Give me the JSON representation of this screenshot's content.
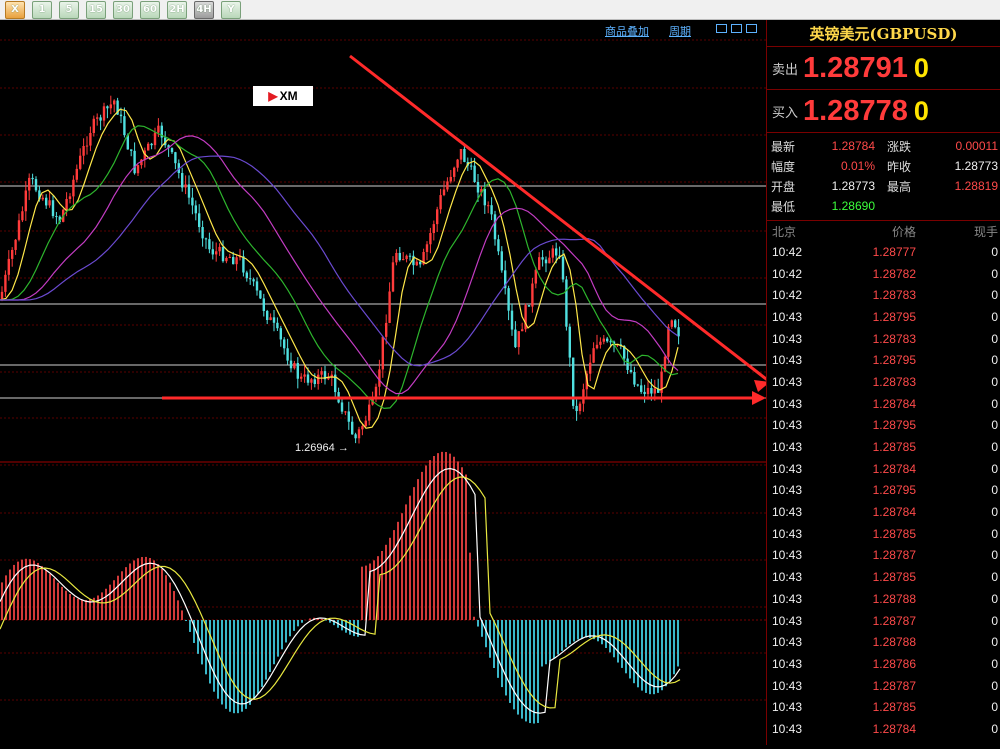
{
  "toolbar": {
    "buttons": [
      {
        "label": "X",
        "style": "orange"
      },
      {
        "label": "1"
      },
      {
        "label": "5"
      },
      {
        "label": "15"
      },
      {
        "label": "30"
      },
      {
        "label": "60"
      },
      {
        "label": "2H"
      },
      {
        "label": "4H",
        "selected": true
      },
      {
        "label": "Y"
      }
    ]
  },
  "chart": {
    "links": [
      "商品叠加",
      "周期"
    ],
    "low_label": "1.26964"
  },
  "panel": {
    "title": "英镑美元(GBPUSD)",
    "sell_label": "卖出",
    "sell_price": "1.28791",
    "sell_vol": "0",
    "buy_label": "买入",
    "buy_price": "1.28778",
    "buy_vol": "0",
    "stats": [
      {
        "k": "最新",
        "v": "1.28784",
        "vc": "red",
        "k2": "涨跌",
        "v2": "0.00011",
        "v2c": "red"
      },
      {
        "k": "幅度",
        "v": "0.01%",
        "vc": "red",
        "k2": "昨收",
        "v2": "1.28773",
        "v2c": "white"
      },
      {
        "k": "开盘",
        "v": "1.28773",
        "vc": "white",
        "k2": "最高",
        "v2": "1.28819",
        "v2c": "red"
      },
      {
        "k": "最低",
        "v": "1.28690",
        "vc": "green",
        "k2": "",
        "v2": "",
        "v2c": "white"
      }
    ],
    "tick_headers": [
      "北京",
      "价格",
      "现手"
    ],
    "ticks": [
      {
        "t": "10:42",
        "p": "1.28777",
        "q": "0"
      },
      {
        "t": "10:42",
        "p": "1.28782",
        "q": "0"
      },
      {
        "t": "10:42",
        "p": "1.28783",
        "q": "0"
      },
      {
        "t": "10:43",
        "p": "1.28795",
        "q": "0"
      },
      {
        "t": "10:43",
        "p": "1.28783",
        "q": "0"
      },
      {
        "t": "10:43",
        "p": "1.28795",
        "q": "0"
      },
      {
        "t": "10:43",
        "p": "1.28783",
        "q": "0"
      },
      {
        "t": "10:43",
        "p": "1.28784",
        "q": "0"
      },
      {
        "t": "10:43",
        "p": "1.28795",
        "q": "0"
      },
      {
        "t": "10:43",
        "p": "1.28785",
        "q": "0"
      },
      {
        "t": "10:43",
        "p": "1.28784",
        "q": "0"
      },
      {
        "t": "10:43",
        "p": "1.28795",
        "q": "0"
      },
      {
        "t": "10:43",
        "p": "1.28784",
        "q": "0"
      },
      {
        "t": "10:43",
        "p": "1.28785",
        "q": "0"
      },
      {
        "t": "10:43",
        "p": "1.28787",
        "q": "0"
      },
      {
        "t": "10:43",
        "p": "1.28785",
        "q": "0"
      },
      {
        "t": "10:43",
        "p": "1.28788",
        "q": "0"
      },
      {
        "t": "10:43",
        "p": "1.28787",
        "q": "0"
      },
      {
        "t": "10:43",
        "p": "1.28788",
        "q": "0"
      },
      {
        "t": "10:43",
        "p": "1.28786",
        "q": "0"
      },
      {
        "t": "10:43",
        "p": "1.28787",
        "q": "0"
      },
      {
        "t": "10:43",
        "p": "1.28785",
        "q": "0"
      },
      {
        "t": "10:43",
        "p": "1.28784",
        "q": "0"
      }
    ]
  },
  "colors": {
    "up_candle": "#ff3b3b",
    "down_candle": "#4fe0e0",
    "trendline": "#ff2a2a",
    "ma_fast": "#ffe84a",
    "ma_mid": "#2db52d",
    "ma_slow1": "#c23cc2",
    "ma_slow2": "#6a4ad0",
    "macd_dif": "#ffffff",
    "macd_dea": "#e8e840"
  }
}
